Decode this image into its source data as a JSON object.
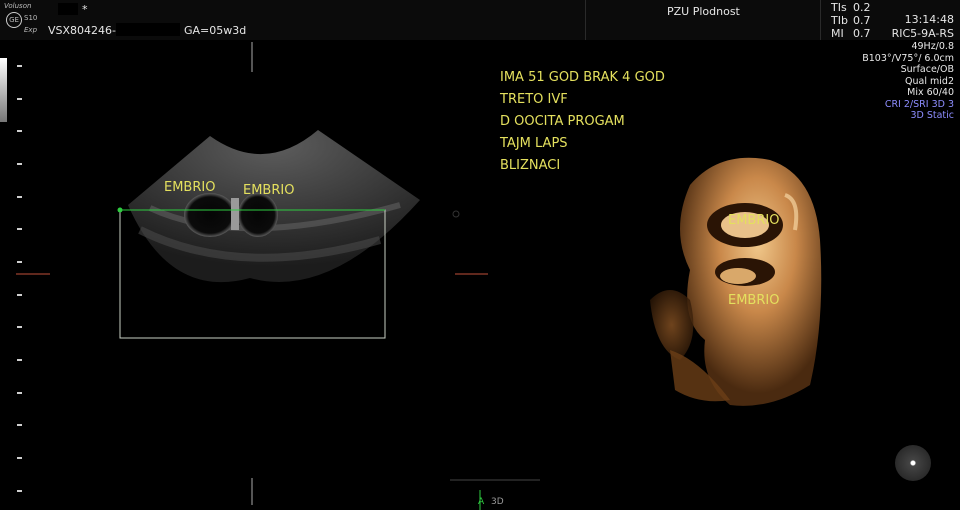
{
  "header": {
    "logo_brand": "Voluson",
    "logo_model": "S10",
    "logo_exp": "Exp",
    "patient_asterisk": "*",
    "patient_id": "VSX804246-",
    "gestational_age": "GA=05w3d",
    "clinic": "PZU Plodnost",
    "tis_label": "TIs",
    "tis_value": "0.2",
    "tib_label": "TIb",
    "tib_value": "0.7",
    "mi_label": "MI",
    "mi_value": "0.7",
    "time": "13:14:48",
    "probe": "RIC5-9A-RS"
  },
  "params": [
    "49Hz/0.8",
    "B103°/V75°/ 6.0cm",
    "Surface/OB",
    "Qual mid2",
    "Mix 60/40"
  ],
  "params_blue": [
    "CRI 2/SRI 3D 3",
    "3D Static"
  ],
  "annotation_lines": [
    "IMA  51 GOD  BRAK 4 GOD",
    "TRETO IVF",
    "D OOCITA PROGAM",
    "TAJM LAPS",
    "BLIZNACI"
  ],
  "labels_2d": [
    "EMBRIO",
    "EMBRIO"
  ],
  "labels_3d": [
    "EMBRIO",
    "EMBRIO"
  ],
  "footer": {
    "a_label": "A",
    "mode_label": "3D"
  },
  "colors": {
    "annotation": "#e4e05e",
    "roi_box": "#c9d0c4",
    "roi_marker": "#2ecc40",
    "render_3d": "#c9884a",
    "params_blue": "#8d8dff"
  }
}
